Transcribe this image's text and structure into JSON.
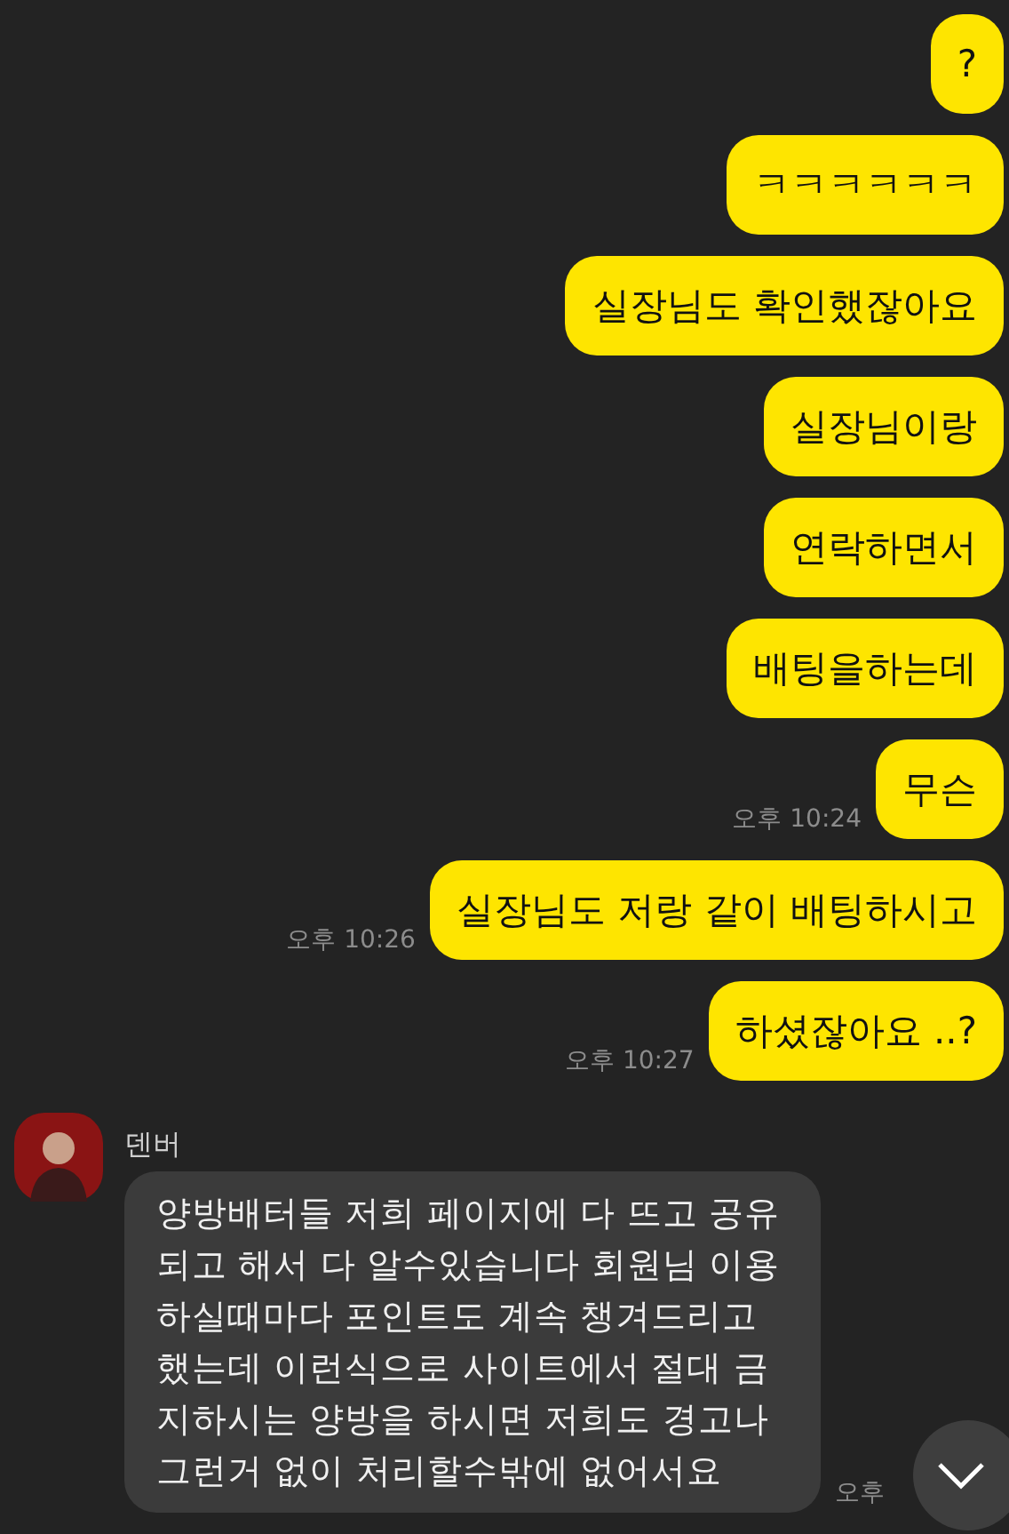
{
  "messages": [
    {
      "kind": "sent",
      "text": "?"
    },
    {
      "kind": "sent",
      "text": "ㅋㅋㅋㅋㅋㅋ"
    },
    {
      "kind": "sent",
      "text": "실장님도 확인했잖아요"
    },
    {
      "kind": "sent",
      "text": "실장님이랑"
    },
    {
      "kind": "sent",
      "text": "연락하면서"
    },
    {
      "kind": "sent",
      "text": "배팅을하는데"
    },
    {
      "kind": "sent",
      "text": "무슨",
      "time": "오후 10:24"
    },
    {
      "kind": "sent",
      "text": "실장님도 저랑 같이 배팅하시고",
      "time": "오후 10:26"
    },
    {
      "kind": "sent",
      "text": "하셨잖아요 ..?",
      "time": "오후 10:27"
    },
    {
      "kind": "received",
      "sender": "덴버",
      "text": "양방배터들 저희 페이지에 다 뜨고 공유되고 해서 다 알수있습니다 회원님 이용하실때마다 포인트도 계속 챙겨드리고 했는데 이런식으로 사이트에서 절대 금지하시는 양방을 하시면 저희도 경고나 그런거 없이 처리할수밖에 없어서요",
      "time": "오후"
    }
  ]
}
